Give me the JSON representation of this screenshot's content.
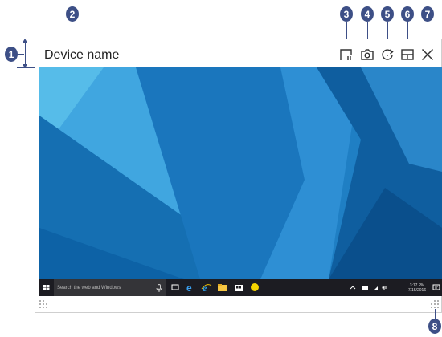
{
  "window": {
    "title": "Device name"
  },
  "callouts": [
    "1",
    "2",
    "3",
    "4",
    "5",
    "6",
    "7",
    "8"
  ],
  "toolbar_icons": [
    "screen-ratio-icon",
    "camera-icon",
    "rotate-icon",
    "layout-icon",
    "close-icon"
  ],
  "taskbar": {
    "search_placeholder": "Search the web and Windows",
    "time": "3:17 PM",
    "date": "7/15/2016"
  },
  "colors": {
    "callout": "#3d4f86",
    "desktop_blue": "#1f7fc4",
    "taskbar": "#1c1c22"
  }
}
